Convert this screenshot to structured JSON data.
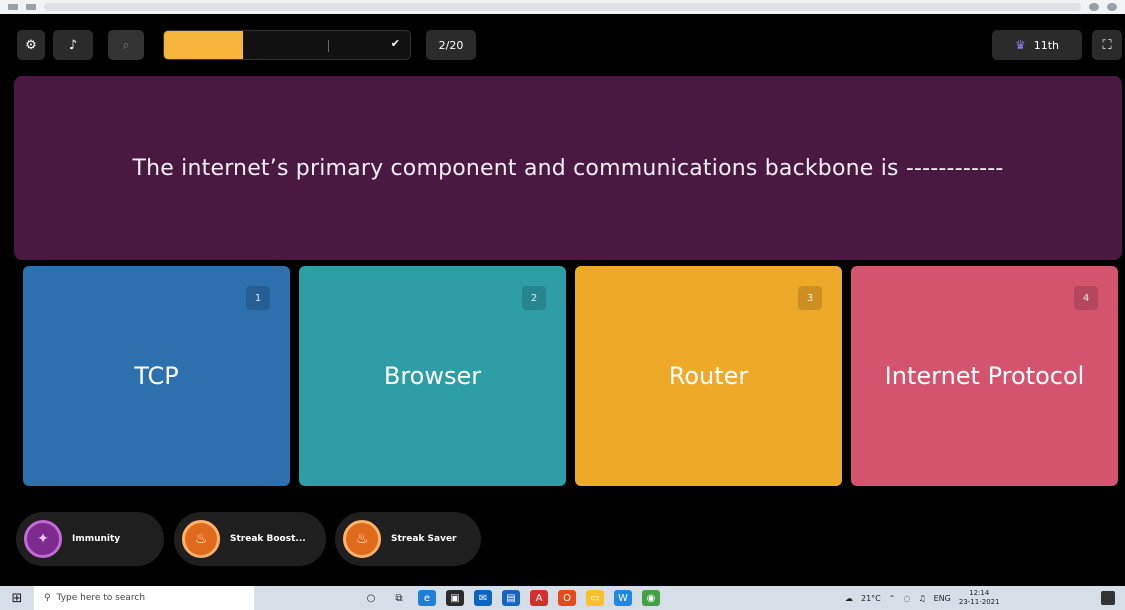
{
  "toolbar": {
    "settings_icon": "⚙",
    "music_icon": "♪",
    "search_icon": "⌕",
    "progress_fraction": 0.32,
    "progress_label": "",
    "progress_end_icon": "✔",
    "question_counter": "2/20",
    "rank_icon": "medal-icon",
    "rank_label": "11th",
    "fullscreen_icon": "⛶"
  },
  "question": {
    "text": "The internet’s primary component and communications backbone is ------------"
  },
  "options": [
    {
      "number": "1",
      "label": "TCP",
      "color": "#2d70ae"
    },
    {
      "number": "2",
      "label": "Browser",
      "color": "#2d9da6"
    },
    {
      "number": "3",
      "label": "Router",
      "color": "#efa929"
    },
    {
      "number": "4",
      "label": "Internet Protocol",
      "color": "#d5546d"
    }
  ],
  "powerups": [
    {
      "label": "Immunity",
      "icon": "shield-icon"
    },
    {
      "label": "Streak Boost...",
      "icon": "flame-icon"
    },
    {
      "label": "Streak Saver",
      "icon": "flame-icon"
    }
  ],
  "taskbar": {
    "search_placeholder": "Type here to search",
    "weather": "21°C",
    "language": "ENG",
    "time": "12:14",
    "date": "23-11-2021"
  }
}
